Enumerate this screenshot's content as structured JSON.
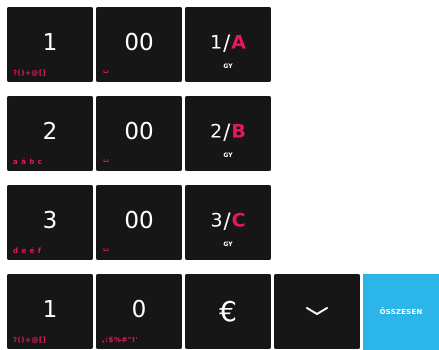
{
  "rows": [
    {
      "digit": {
        "main": "1",
        "sub": "?()+@[]"
      },
      "zero": {
        "main": "00",
        "sub": "␣"
      },
      "fn": {
        "num": "1",
        "slash": "/",
        "letter": "A",
        "sub": "GY"
      }
    },
    {
      "digit": {
        "main": "2",
        "sub": "a á b c"
      },
      "zero": {
        "main": "00",
        "sub": "␣"
      },
      "fn": {
        "num": "2",
        "slash": "/",
        "letter": "B",
        "sub": "GY"
      }
    },
    {
      "digit": {
        "main": "3",
        "sub": "d e é f"
      },
      "zero": {
        "main": "00",
        "sub": "␣"
      },
      "fn": {
        "num": "3",
        "slash": "/",
        "letter": "C",
        "sub": "GY"
      }
    }
  ],
  "bottom": {
    "one": {
      "main": "1",
      "sub": "?()+@[]"
    },
    "zero": {
      "main": "0",
      "sub": ",:$%#\"!'"
    },
    "euro": {
      "main": "€",
      "icon": "euro-icon"
    },
    "down": {
      "icon": "chevron-down-icon"
    },
    "total": {
      "label": "ÖSSZESEN"
    }
  },
  "colors": {
    "key_bg": "#161616",
    "accent": "#e8175d",
    "total_bg": "#2bb5e8"
  }
}
